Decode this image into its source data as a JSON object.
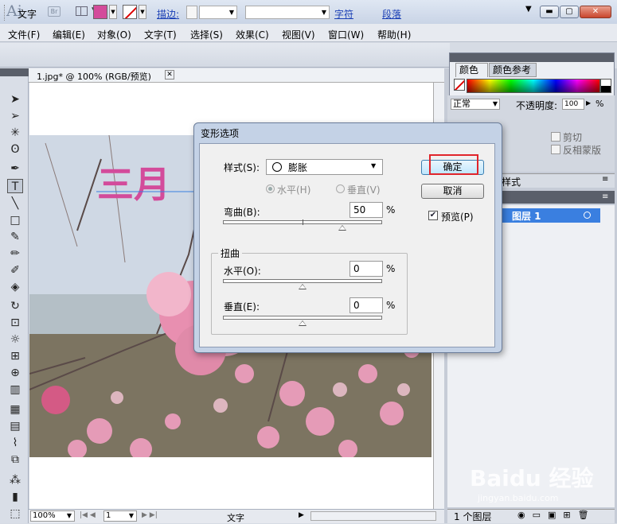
{
  "app": {
    "logo": "Ai",
    "bridge": "Br"
  },
  "window": {
    "minimize": "▬",
    "maximize": "▢",
    "close": "✕"
  },
  "menubar": [
    "文件(F)",
    "编辑(E)",
    "对象(O)",
    "文字(T)",
    "选择(S)",
    "效果(C)",
    "视图(V)",
    "窗口(W)",
    "帮助(H)"
  ],
  "control": {
    "tool_label": "文字",
    "stroke_label": "描边:",
    "character": "字符",
    "paragraph": "段落"
  },
  "document": {
    "tab": "1.jpg* @ 100% (RGB/预览)",
    "close": "✕"
  },
  "canvas": {
    "text_art": "三月",
    "photo_desc": "peach blossom"
  },
  "status": {
    "zoom": "100%",
    "page": "1",
    "tool_text": "文字"
  },
  "color_panel": {
    "tab_color": "颜色",
    "tab_guide": "颜色参考"
  },
  "transparency": {
    "blend": "正常",
    "opacity_label": "不透明度:",
    "opacity_value": "100",
    "percent": "%",
    "clip": "剪切",
    "invert": "反相蒙版"
  },
  "graphic_styles": {
    "label": "样式"
  },
  "layers": {
    "layer_name": "图层 1",
    "count": "1 个图层"
  },
  "dialog": {
    "title": "变形选项",
    "style_label": "样式(S):",
    "style_value": "膨胀",
    "horizontal": "水平(H)",
    "vertical": "垂直(V)",
    "bend_label": "弯曲(B):",
    "bend_value": "50",
    "distortion_group": "扭曲",
    "dist_h_label": "水平(O):",
    "dist_h_value": "0",
    "dist_v_label": "垂直(E):",
    "dist_v_value": "0",
    "percent": "%",
    "ok": "确定",
    "cancel": "取消",
    "preview": "预览(P)",
    "preview_checked": true,
    "bend_fraction": 0.75,
    "dist_h_fraction": 0.5,
    "dist_v_fraction": 0.5
  },
  "watermark": {
    "brand": "Baidu 经验",
    "url": "jingyan.baidu.com"
  },
  "colors": {
    "fill": "#d34b9b",
    "selection": "#3a7fe0",
    "highlight": "#e0252b"
  }
}
